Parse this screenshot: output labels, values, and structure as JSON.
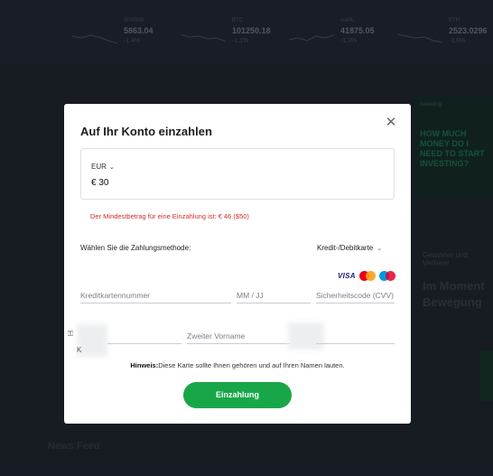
{
  "ticker": [
    {
      "symbol": "SPX500",
      "value": "5863.04",
      "change": "-1.4%"
    },
    {
      "symbol": "BTC",
      "value": "101250.18",
      "change": "-1.1%"
    },
    {
      "symbol": "AAPL",
      "value": "41875.05",
      "change": "-1.3%"
    },
    {
      "symbol": "ETH",
      "value": "2523.0296",
      "change": "-3.6%"
    }
  ],
  "background": {
    "promo_label": "Investing",
    "promo_text": "HOW MUCH MONEY DO I NEED TO START INVESTING?",
    "side_text": "Gewinner und Verlierer",
    "side_big": "Im Moment Bewegung",
    "news_feed": "News Feed"
  },
  "modal": {
    "title": "Auf Ihr Konto einzahlen",
    "close_icon": "close-icon",
    "currency": "EUR",
    "amount": "€ 30",
    "error": "Der Mindestbetrag für eine Einzahlung ist: € 46 ($50)",
    "payment_method_label": "Wählen Sie die Zahlungsmethode:",
    "payment_method_value": "Kredit-/Debitkarte",
    "card_brands": [
      "VISA",
      "mastercard",
      "maestro"
    ],
    "fields": {
      "card_number_placeholder": "Kreditkartennummer",
      "expiry_placeholder": "MM / JJ",
      "cvv_placeholder": "Sicherheitscode (CVV)",
      "middle_name_placeholder": "Zweiter Vorname"
    },
    "hint_bold": "Hinweis:",
    "hint_text": "Diese Karte sollte Ihnen gehören und auf Ihren Namen lauten.",
    "submit_label": "Einzahlung",
    "colors": {
      "primary": "#18a748",
      "error": "#d12b2b"
    }
  }
}
